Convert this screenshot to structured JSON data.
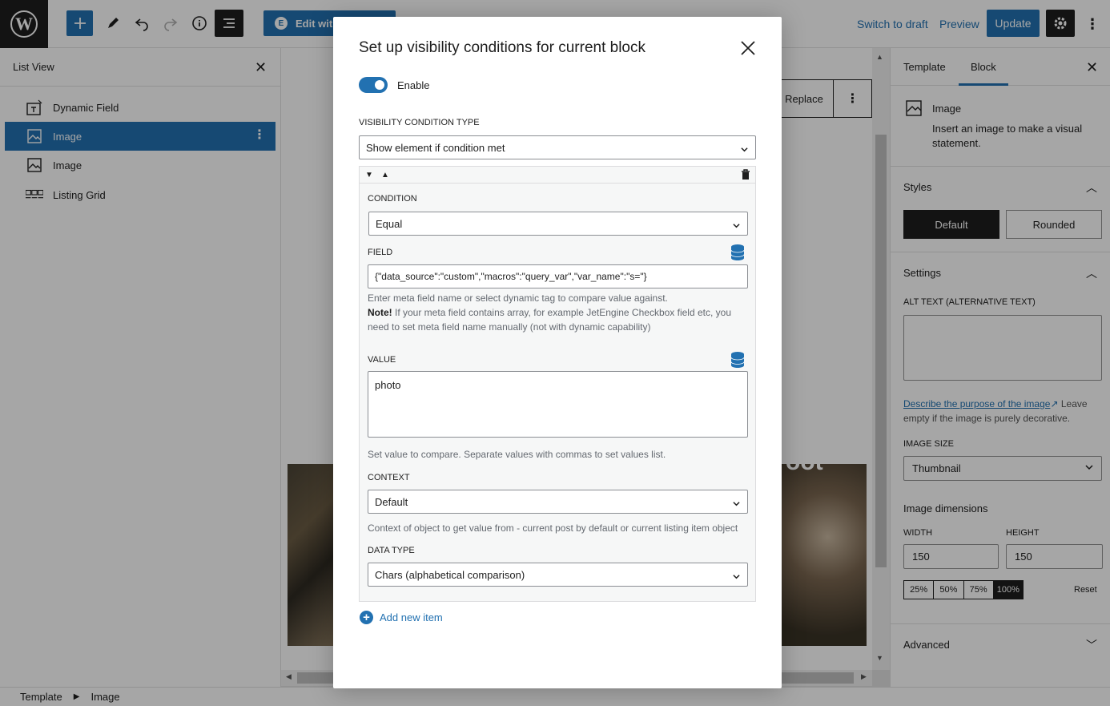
{
  "topbar": {
    "logo": "W",
    "edit_with": "Edit with",
    "switch_to_draft": "Switch to draft",
    "preview": "Preview",
    "update": "Update"
  },
  "list_view": {
    "title": "List View",
    "items": [
      {
        "label": "Dynamic Field",
        "icon": "dynamic-field-icon"
      },
      {
        "label": "Image",
        "icon": "image-icon"
      },
      {
        "label": "Image",
        "icon": "image-icon"
      },
      {
        "label": "Listing Grid",
        "icon": "listing-grid-icon"
      }
    ]
  },
  "canvas": {
    "replace": "Replace",
    "image_overlay_text": "oot"
  },
  "sidebar": {
    "tabs": [
      "Template",
      "Block"
    ],
    "block_title": "Image",
    "block_desc": "Insert an image to make a visual statement.",
    "styles_title": "Styles",
    "style_default": "Default",
    "style_rounded": "Rounded",
    "settings_title": "Settings",
    "alt_label": "ALT TEXT (ALTERNATIVE TEXT)",
    "help_link": "Describe the purpose of the image",
    "help_text": "Leave empty if the image is purely decorative.",
    "image_size_label": "IMAGE SIZE",
    "image_size_value": "Thumbnail",
    "dimensions_label": "Image dimensions",
    "width_label": "WIDTH",
    "height_label": "HEIGHT",
    "width_value": "150",
    "height_value": "150",
    "percents": [
      "25%",
      "50%",
      "75%",
      "100%"
    ],
    "reset": "Reset",
    "advanced_title": "Advanced"
  },
  "breadcrumb": {
    "items": [
      "Template",
      "Image"
    ]
  },
  "modal": {
    "title": "Set up visibility conditions for current block",
    "enable_label": "Enable",
    "type_label": "VISIBILITY CONDITION TYPE",
    "type_value": "Show element if condition met",
    "condition_label": "CONDITION",
    "condition_value": "Equal",
    "field_label": "FIELD",
    "field_value": "{\"data_source\":\"custom\",\"macros\":\"query_var\",\"var_name\":\"s=\"}",
    "field_help_1": "Enter meta field name or select dynamic tag to compare value against.",
    "field_help_note": "Note!",
    "field_help_2": " If your meta field contains array, for example JetEngine Checkbox field etc, you need to set meta field name manually (not with dynamic capability)",
    "value_label": "VALUE",
    "value_value": "photo",
    "value_help": "Set value to compare. Separate values with commas to set values list.",
    "context_label": "CONTEXT",
    "context_value": "Default",
    "context_help": "Context of object to get value from - current post by default or current listing item object",
    "data_type_label": "DATA TYPE",
    "data_type_value": "Chars (alphabetical comparison)",
    "add_new_item": "Add new item"
  }
}
